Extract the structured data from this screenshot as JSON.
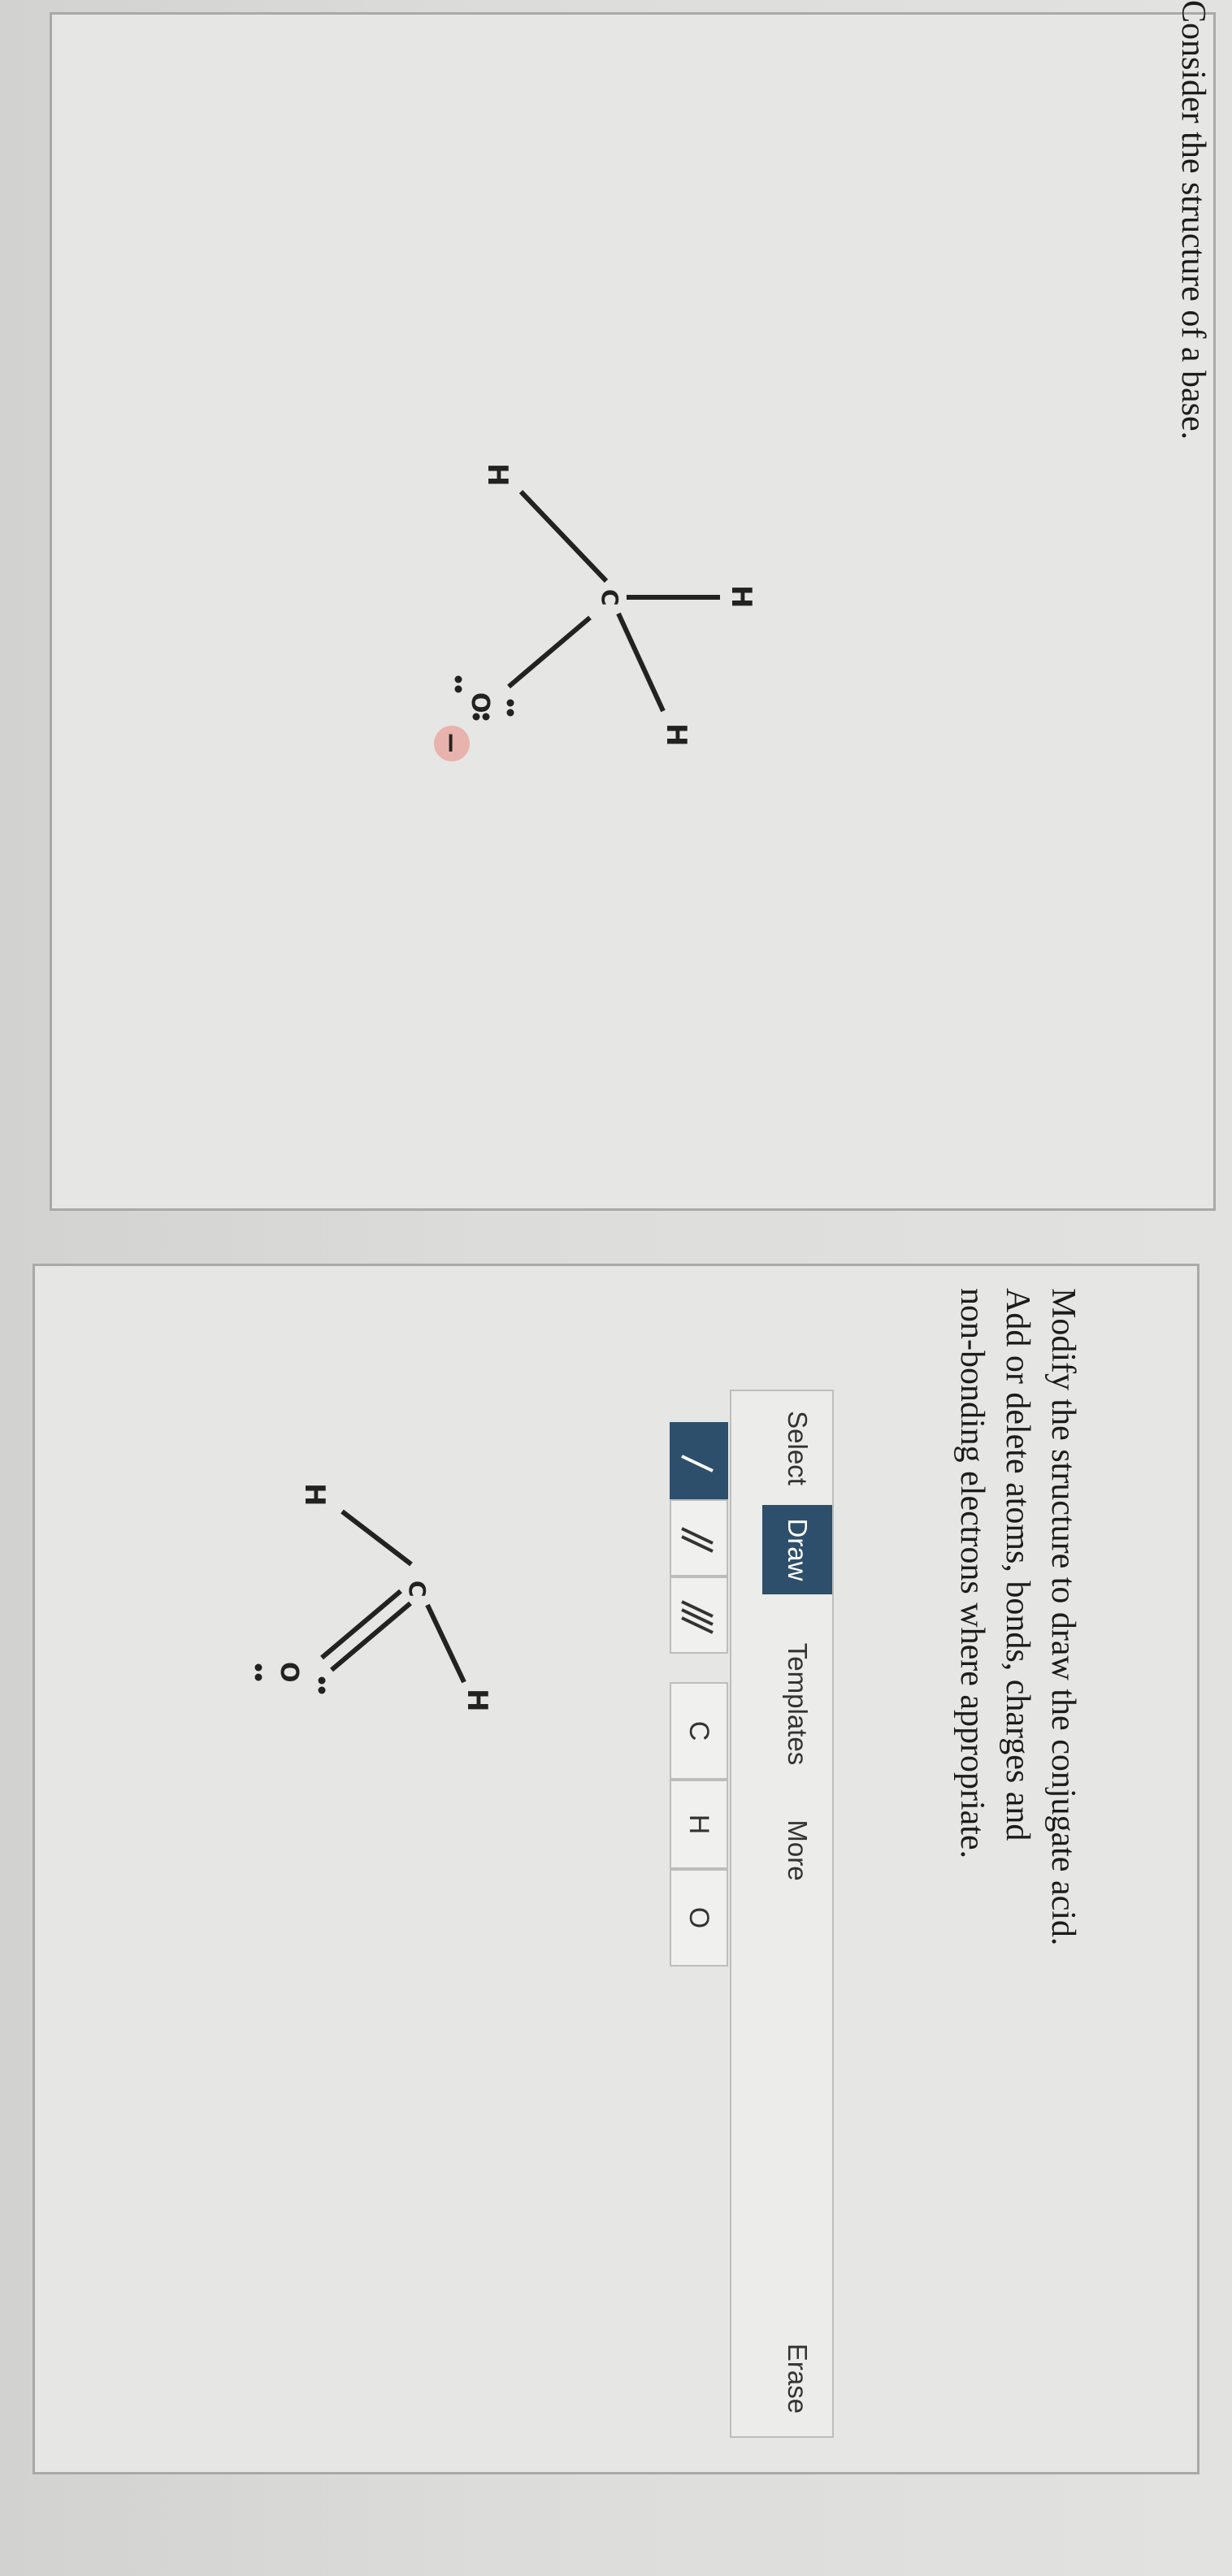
{
  "base_prompt": "Consider the structure of a base.",
  "acid_prompt": {
    "line1": "Modify the structure to draw the conjugate acid.",
    "line2": "Add or delete atoms, bonds, charges and",
    "line3": "non-bonding electrons where appropriate."
  },
  "toolbar": {
    "tabs": {
      "select": "Select",
      "draw": "Draw",
      "templates": "Templates",
      "more": "More"
    },
    "erase": "Erase",
    "atoms": {
      "c": "C",
      "h": "H",
      "o": "O"
    },
    "bond_icons": [
      "single-bond-icon",
      "double-bond-icon",
      "triple-bond-icon"
    ],
    "active_color": "#2d4f6b"
  },
  "base_molecule": {
    "atoms": {
      "h_top": "H",
      "c": "C",
      "h_left": "H",
      "h_right": "H",
      "o": "O",
      "charge": "−"
    }
  },
  "acid_molecule": {
    "atoms": {
      "h_left": "H",
      "c": "C",
      "h_right": "H",
      "o": "O"
    }
  }
}
